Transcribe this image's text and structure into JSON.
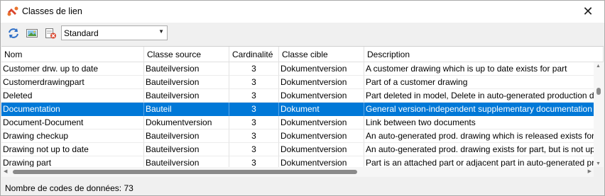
{
  "window": {
    "title": "Classes de lien",
    "close_symbol": "✕"
  },
  "toolbar": {
    "icons": [
      "refresh-icon",
      "image-icon",
      "delete-icon"
    ],
    "view_select": {
      "value": "Standard",
      "arrow": "▼"
    }
  },
  "table": {
    "columns": [
      "Nom",
      "Classe source",
      "Cardinalité",
      "Classe cible",
      "Description"
    ],
    "rows": [
      [
        "Customer drw. up to date",
        "Bauteilversion",
        "3",
        "Dokumentversion",
        "A customer drawing which is up to date exists for part"
      ],
      [
        "Customerdrawingpart",
        "Bauteilversion",
        "3",
        "Dokumentversion",
        "Part of a customer drawing"
      ],
      [
        "Deleted",
        "Bauteilversion",
        "3",
        "Dokumentversion",
        "Part deleted in model, Delete in auto-generated production d"
      ],
      [
        "Documentation",
        "Bauteil",
        "3",
        "Dokument",
        "General version-independent supplementary documentation"
      ],
      [
        "Document-Document",
        "Dokumentversion",
        "3",
        "Dokumentversion",
        "Link between two documents"
      ],
      [
        "Drawing checkup",
        "Bauteilversion",
        "3",
        "Dokumentversion",
        "An auto-generated prod. drawing which is released exists for"
      ],
      [
        "Drawing not up to date",
        "Bauteilversion",
        "3",
        "Dokumentversion",
        "An auto-generated prod. drawing exists for part, but is not up"
      ],
      [
        "Drawing part",
        "Bauteilversion",
        "3",
        "Dokumentversion",
        "Part is an attached part or adjacent part in auto-generated pr"
      ]
    ],
    "selected_row": 3
  },
  "scroll": {
    "up": "▲",
    "down": "▼",
    "left": "◀",
    "right": "▶"
  },
  "status": {
    "text": "Nombre de codes de données: 73"
  },
  "colors": {
    "selection": "#0078d7",
    "accent_red": "#c0392b"
  }
}
